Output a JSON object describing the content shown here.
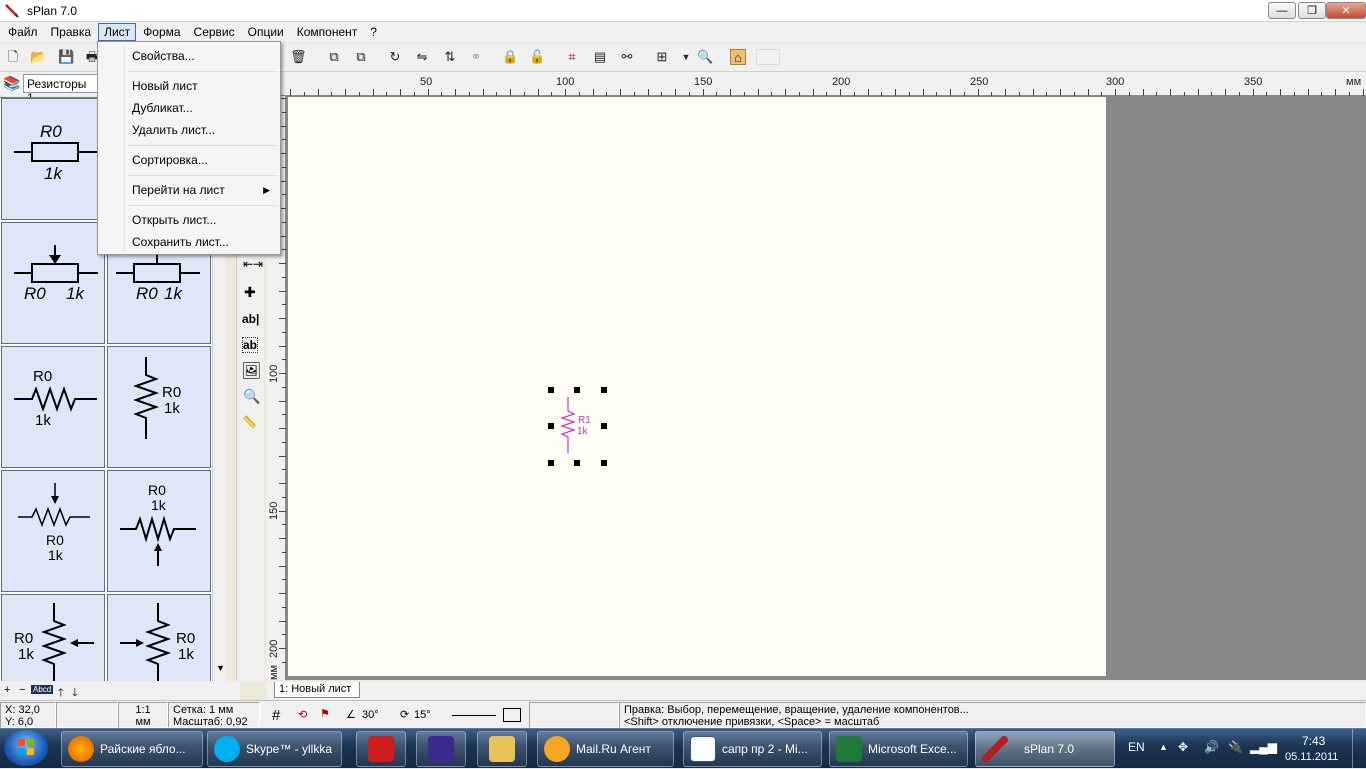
{
  "window": {
    "title": "sPlan 7.0"
  },
  "menubar": [
    "Файл",
    "Правка",
    "Лист",
    "Форма",
    "Сервис",
    "Опции",
    "Компонент",
    "?"
  ],
  "sheet_menu": {
    "items": [
      "Свойства...",
      "Новый лист",
      "Дубликат...",
      "Удалить лист...",
      "Сортировка...",
      "Перейти на лист",
      "Открыть лист...",
      "Сохранить лист..."
    ]
  },
  "library": {
    "combo_value": "Резисторы 1",
    "cells": [
      {
        "name": "R0",
        "value": "1k"
      },
      {
        "name": "R0",
        "value": "1k"
      },
      {
        "name": "R0",
        "value": "1k"
      },
      {
        "name": "R0",
        "value": "1k"
      },
      {
        "name": "R0",
        "value": "1k"
      },
      {
        "name": "R0",
        "value": "1k"
      },
      {
        "name": "R0",
        "value": "1k"
      },
      {
        "name": "R0",
        "value": "1k"
      },
      {
        "name": "R0",
        "value": "1k"
      }
    ],
    "footer_label": "Abcd"
  },
  "ruler": {
    "h_labels": [
      "50",
      "100",
      "150",
      "200",
      "250",
      "300",
      "350",
      "мм"
    ],
    "v_labels": [
      "100",
      "150",
      "200",
      "мм"
    ]
  },
  "canvas": {
    "component_name": "R1",
    "component_value": "1k",
    "component_color": "#cc33cc",
    "sheet_color": "#fffef5",
    "workspace_color": "#888888"
  },
  "sheet_tab": "1: Новый лист",
  "status": {
    "x": "X: 32,0",
    "y": "Y: 6,0",
    "scale_ratio": "1:1",
    "unit": "мм",
    "grid": "Сетка: 1 мм",
    "zoom": "Масштаб:  0,92",
    "angle1": "30°",
    "angle2": "15°",
    "hint1": "Правка: Выбор, перемещение, вращение, удаление компонентов...",
    "hint2": "<Shift> отключение привязки, <Space> = масштаб"
  },
  "taskbar": {
    "tasks": [
      "Райские ябло...",
      "Skype™ - yllkka",
      "",
      "",
      "",
      "Mail.Ru Агент",
      "сапр пр 2 - Mi...",
      "Microsoft Exce...",
      "sPlan 7.0"
    ],
    "lang": "EN",
    "time": "7:43",
    "date": "05.11.2011"
  }
}
